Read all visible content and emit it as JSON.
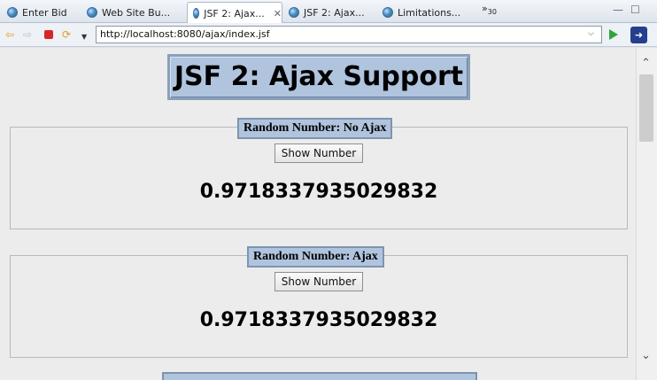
{
  "browser": {
    "tabs": [
      {
        "label": "Enter Bid"
      },
      {
        "label": "Web Site Bu..."
      },
      {
        "label": "JSF 2: Ajax..."
      },
      {
        "label": "JSF 2: Ajax..."
      },
      {
        "label": "Limitations..."
      }
    ],
    "overflow_label": "»",
    "overflow_count": "30",
    "address": "http://localhost:8080/ajax/index.jsf"
  },
  "page": {
    "title": "JSF 2: Ajax Support",
    "sections": [
      {
        "legend": "Random Number: No Ajax",
        "button_label": "Show Number",
        "value": "0.9718337935029832"
      },
      {
        "legend": "Random Number: Ajax",
        "button_label": "Show Number",
        "value": "0.9718337935029832"
      }
    ]
  },
  "colors": {
    "heading_bg": "#b0c4de",
    "heading_border": "#7e94ae",
    "page_bg": "#ececec"
  }
}
